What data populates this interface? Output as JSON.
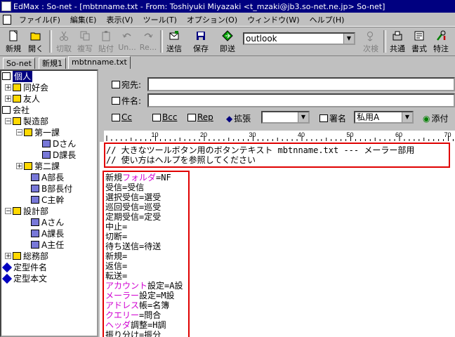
{
  "window": {
    "title": "EdMax : So-net - [mbtnname.txt - From: Toshiyuki Miyazaki <t_mzaki@jb3.so-net.ne.jp> So-net]"
  },
  "menu": [
    "ファイル(F)",
    "編集(E)",
    "表示(V)",
    "ツール(T)",
    "オプション(O)",
    "ウィンドウ(W)",
    "ヘルプ(H)"
  ],
  "toolbar": {
    "buttons": [
      {
        "label": "新規",
        "icon": "new-doc-icon"
      },
      {
        "label": "開く",
        "icon": "open-folder-icon"
      },
      {
        "label": "切取",
        "icon": "scissors-icon"
      },
      {
        "label": "複写",
        "icon": "copy-icon"
      },
      {
        "label": "貼付",
        "icon": "paste-icon"
      },
      {
        "label": "Un...",
        "icon": "undo-icon"
      },
      {
        "label": "Re...",
        "icon": "redo-icon"
      },
      {
        "label": "送信",
        "icon": "send-icon"
      },
      {
        "label": "保存",
        "icon": "save-icon"
      },
      {
        "label": "即送",
        "icon": "send-now-icon"
      },
      {
        "label": "次検",
        "icon": "find-next-icon"
      },
      {
        "label": "共通",
        "icon": "common-icon"
      },
      {
        "label": "書式",
        "icon": "format-icon"
      },
      {
        "label": "特注",
        "icon": "tools-icon"
      }
    ],
    "combo_value": "outlook"
  },
  "tabs": [
    "So-net",
    "新規1",
    "mbtnname.txt"
  ],
  "tree": [
    {
      "label": "個人",
      "selected": true
    },
    {
      "label": "同好会"
    },
    {
      "label": "友人"
    },
    {
      "label": "会社"
    },
    {
      "label": "製造部"
    },
    {
      "label": "第一課"
    },
    {
      "label": "Dさん"
    },
    {
      "label": "D課長"
    },
    {
      "label": "第二課"
    },
    {
      "label": "A部長"
    },
    {
      "label": "B部長付"
    },
    {
      "label": "C主幹"
    },
    {
      "label": "設計部"
    },
    {
      "label": "Aさん"
    },
    {
      "label": "A課長"
    },
    {
      "label": "A主任"
    },
    {
      "label": "総務部"
    },
    {
      "label": "定型件名"
    },
    {
      "label": "定型本文"
    }
  ],
  "form": {
    "to_label": "宛先:",
    "subject_label": "件名:",
    "cc_label": "Cc",
    "bcc_label": "Bcc",
    "rep_label": "Rep",
    "ext_label": "拡張",
    "sign_label": "署名",
    "sign_value": "私用A",
    "attach_label": "添付"
  },
  "ruler": {
    "marks": [
      "10",
      "20",
      "30",
      "40",
      "50",
      "60",
      "70"
    ]
  },
  "editor": {
    "header_lines": [
      "// 大きなツールボタン用のボタンテキスト mbtnname.txt --- メーラー部用",
      "// 使い方はヘルプを参照してください"
    ],
    "lines": [
      {
        "pre": "新規",
        "mag": "フォルダ",
        "post": "=NF"
      },
      {
        "pre": "受信=受信",
        "mag": "",
        "post": ""
      },
      {
        "pre": "選択受信=選受",
        "mag": "",
        "post": ""
      },
      {
        "pre": "巡回受信=巡受",
        "mag": "",
        "post": ""
      },
      {
        "pre": "定期受信=定受",
        "mag": "",
        "post": ""
      },
      {
        "pre": "中止=",
        "mag": "",
        "post": ""
      },
      {
        "pre": "切断=",
        "mag": "",
        "post": ""
      },
      {
        "pre": "待ち送信=待送",
        "mag": "",
        "post": ""
      },
      {
        "pre": "新規=",
        "mag": "",
        "post": ""
      },
      {
        "pre": "返信=",
        "mag": "",
        "post": ""
      },
      {
        "pre": "転送=",
        "mag": "",
        "post": ""
      },
      {
        "pre": "",
        "mag": "アカウント",
        "post": "設定=A設"
      },
      {
        "pre": "",
        "mag": "メーラー",
        "post": "設定=M設"
      },
      {
        "pre": "",
        "mag": "アドレス",
        "post": "帳=名簿"
      },
      {
        "pre": "",
        "mag": "クエリー",
        "post": "=問合"
      },
      {
        "pre": "",
        "mag": "ヘッダ",
        "post": "調整=H調"
      },
      {
        "pre": "振り分け=振分",
        "mag": "",
        "post": ""
      }
    ]
  },
  "colors": {
    "titlebar": "#000080",
    "highlight_box": "#e00000",
    "magenta_text": "#d000d0"
  }
}
